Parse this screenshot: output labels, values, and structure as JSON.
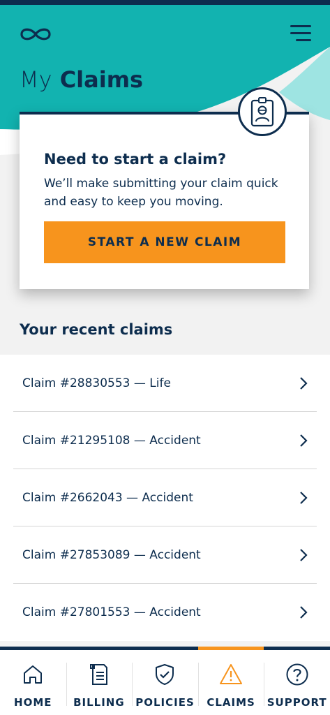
{
  "header": {
    "title_light": "My",
    "title_bold": "Claims",
    "colors": {
      "navy": "#0d2d4e",
      "teal": "#12b3b0",
      "light_teal": "#7fdcd9",
      "accent": "#f7941d"
    },
    "logo_icon": "infinity-icon",
    "menu_icon": "hamburger-menu-icon"
  },
  "start_card": {
    "heading": "Need to start a claim?",
    "body": "We’ll make submitting your claim quick and easy to keep you moving.",
    "cta_label": "START A NEW CLAIM",
    "badge_icon": "id-badge-icon"
  },
  "recent": {
    "title": "Your recent claims",
    "items": [
      {
        "label": "Claim #28830553 — Life"
      },
      {
        "label": "Claim #21295108 — Accident"
      },
      {
        "label": "Claim #2662043 — Accident"
      },
      {
        "label": "Claim #27853089 — Accident"
      },
      {
        "label": "Claim #27801553 — Accident"
      }
    ]
  },
  "nav": {
    "items": [
      {
        "label": "HOME",
        "icon": "home-icon"
      },
      {
        "label": "BILLING",
        "icon": "document-icon"
      },
      {
        "label": "POLICIES",
        "icon": "shield-check-icon"
      },
      {
        "label": "CLAIMS",
        "icon": "warning-triangle-icon",
        "active": true
      },
      {
        "label": "SUPPORT",
        "icon": "question-circle-icon"
      }
    ]
  }
}
